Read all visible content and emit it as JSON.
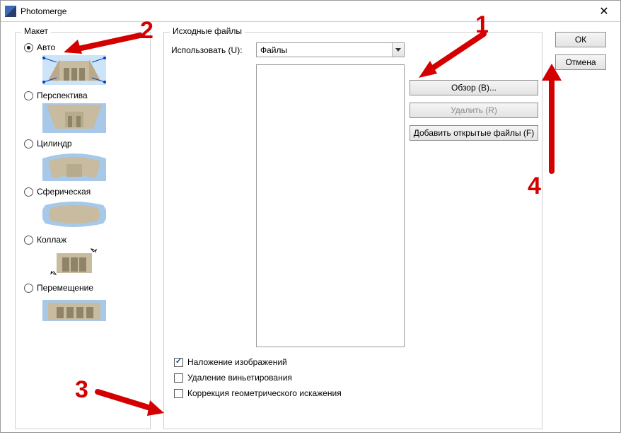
{
  "window": {
    "title": "Photomerge"
  },
  "layout": {
    "legend": "Макет",
    "options": [
      {
        "label": "Авто"
      },
      {
        "label": "Перспектива"
      },
      {
        "label": "Цилиндр"
      },
      {
        "label": "Сферическая"
      },
      {
        "label": "Коллаж"
      },
      {
        "label": "Перемещение"
      }
    ]
  },
  "source": {
    "legend": "Исходные файлы",
    "use_label": "Использовать (U):",
    "use_value": "Файлы",
    "buttons": {
      "browse": "Обзор (B)...",
      "remove": "Удалить (R)",
      "add_open": "Добавить открытые файлы (F)"
    },
    "checks": {
      "blend": "Наложение изображений",
      "vignette": "Удаление виньетирования",
      "geom": "Коррекция геометрического искажения"
    }
  },
  "actions": {
    "ok": "ОК",
    "cancel": "Отмена"
  },
  "annotations": {
    "n1": "1",
    "n2": "2",
    "n3": "3",
    "n4": "4"
  }
}
